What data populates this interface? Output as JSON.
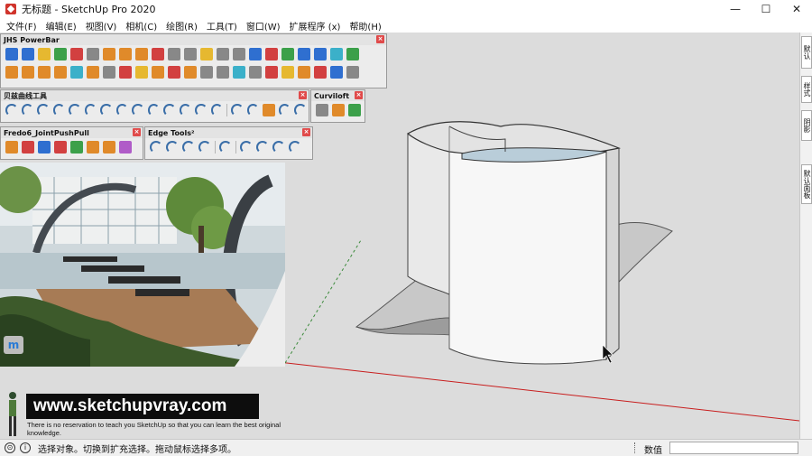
{
  "window": {
    "title": "无标题 - SketchUp Pro 2020",
    "controls": {
      "minimize": "—",
      "maximize": "☐",
      "close": "✕"
    }
  },
  "menu": [
    "文件(F)",
    "编辑(E)",
    "视图(V)",
    "相机(C)",
    "绘图(R)",
    "工具(T)",
    "窗口(W)",
    "扩展程序 (x)",
    "帮助(H)"
  ],
  "toolbars": {
    "jhs": {
      "title": "JHS PowerBar"
    },
    "bezier": {
      "title": "贝兹曲线工具"
    },
    "curviloft": {
      "title": "Curviloft"
    },
    "fredo": {
      "title": "Fredo6_JointPushPull"
    },
    "edge": {
      "title": "Edge Tools²"
    }
  },
  "right_tray": [
    "默认",
    "样式",
    "阴影",
    "默认面板"
  ],
  "watermark": {
    "url": "www.sketchupvray.com",
    "note": "There is no reservation to teach you SketchUp so that you can learn the best original knowledge."
  },
  "float_logo": "m",
  "status": {
    "hint": "选择对象。切换到扩充选择。拖动鼠标选择多项。",
    "measurement_label": "数值",
    "measurement_value": ""
  },
  "colors": {
    "viewport_bg": "#dcdcdc",
    "axis_red": "#c81e1e",
    "toolbar_bg": "#ececec"
  }
}
